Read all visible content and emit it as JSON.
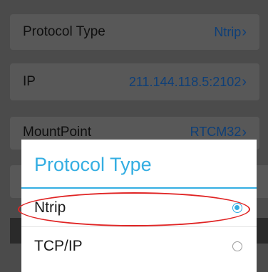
{
  "settings": {
    "rows": [
      {
        "label": "Protocol Type",
        "value": "Ntrip"
      },
      {
        "label": "IP",
        "value": "211.144.118.5:2102"
      },
      {
        "label": "MountPoint",
        "value": "RTCM32"
      }
    ],
    "chevron": "›"
  },
  "dialog": {
    "title": "Protocol Type",
    "options": [
      {
        "label": "Ntrip",
        "selected": true
      },
      {
        "label": "TCP/IP",
        "selected": false
      }
    ]
  },
  "colors": {
    "accent": "#34aee2",
    "value_text": "#0e3f78",
    "annotation": "#e02424",
    "overlay_bg": "#4b4b4b"
  }
}
